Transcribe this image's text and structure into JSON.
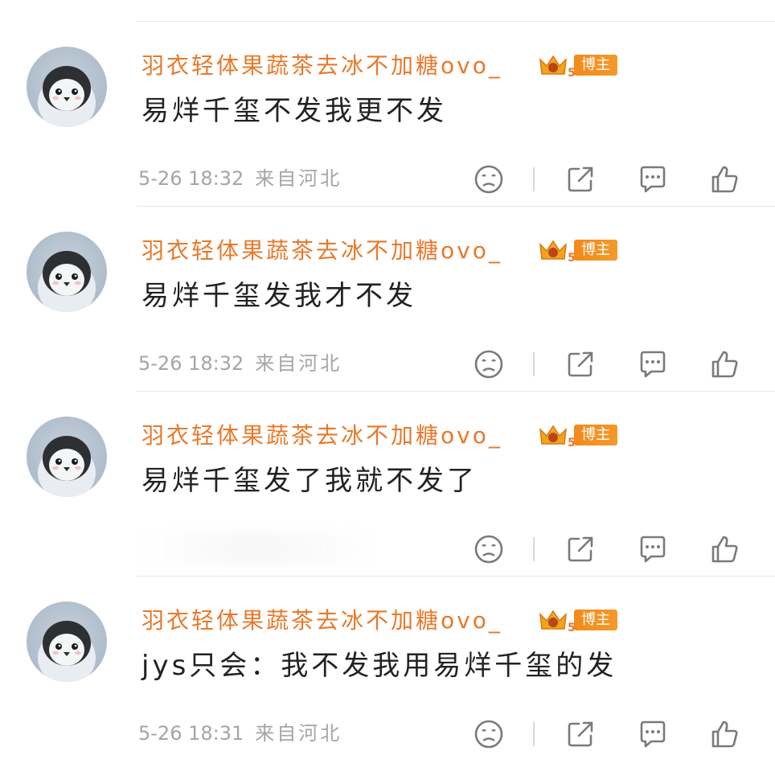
{
  "badge_label": "博主",
  "badge_level": "5",
  "colors": {
    "username": "#e8792b",
    "badge": "#f28a1a",
    "text": "#222222",
    "meta": "#a5a5a5",
    "icon": "#7a7a7a"
  },
  "icons": [
    "dislike-icon",
    "share-icon",
    "comment-icon",
    "like-icon"
  ],
  "comments": [
    {
      "username": "羽衣轻体果蔬茶去冰不加糖ovo_",
      "text": "易烊千玺不发我更不发",
      "time": "5-26 18:32",
      "source": "来自河北"
    },
    {
      "username": "羽衣轻体果蔬茶去冰不加糖ovo_",
      "text": "易烊千玺发我才不发",
      "time": "5-26 18:32",
      "source": "来自河北"
    },
    {
      "username": "羽衣轻体果蔬茶去冰不加糖ovo_",
      "text": "易烊千玺发了我就不发了",
      "time": "",
      "source": ""
    },
    {
      "username": "羽衣轻体果蔬茶去冰不加糖ovo_",
      "text": "jys只会：我不发我用易烊千玺的发",
      "time": "5-26 18:31",
      "source": "来自河北"
    }
  ]
}
